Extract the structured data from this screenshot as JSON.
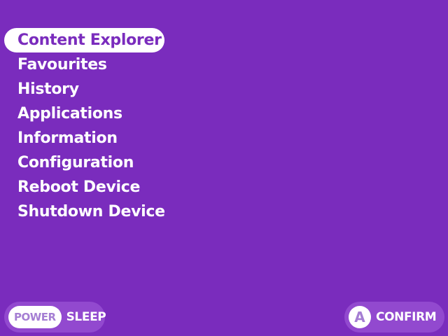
{
  "menu": {
    "items": [
      {
        "label": "Content Explorer",
        "selected": true
      },
      {
        "label": "Favourites",
        "selected": false
      },
      {
        "label": "History",
        "selected": false
      },
      {
        "label": "Applications",
        "selected": false
      },
      {
        "label": "Information",
        "selected": false
      },
      {
        "label": "Configuration",
        "selected": false
      },
      {
        "label": "Reboot Device",
        "selected": false
      },
      {
        "label": "Shutdown Device",
        "selected": false
      }
    ]
  },
  "footer": {
    "left": {
      "key": "POWER",
      "action": "SLEEP"
    },
    "right": {
      "key": "A",
      "action": "CONFIRM"
    }
  },
  "colors": {
    "background": "#7a2cbd",
    "highlight": "#ffffff",
    "pill": "#9249cf",
    "key_text": "#a57ed3"
  }
}
